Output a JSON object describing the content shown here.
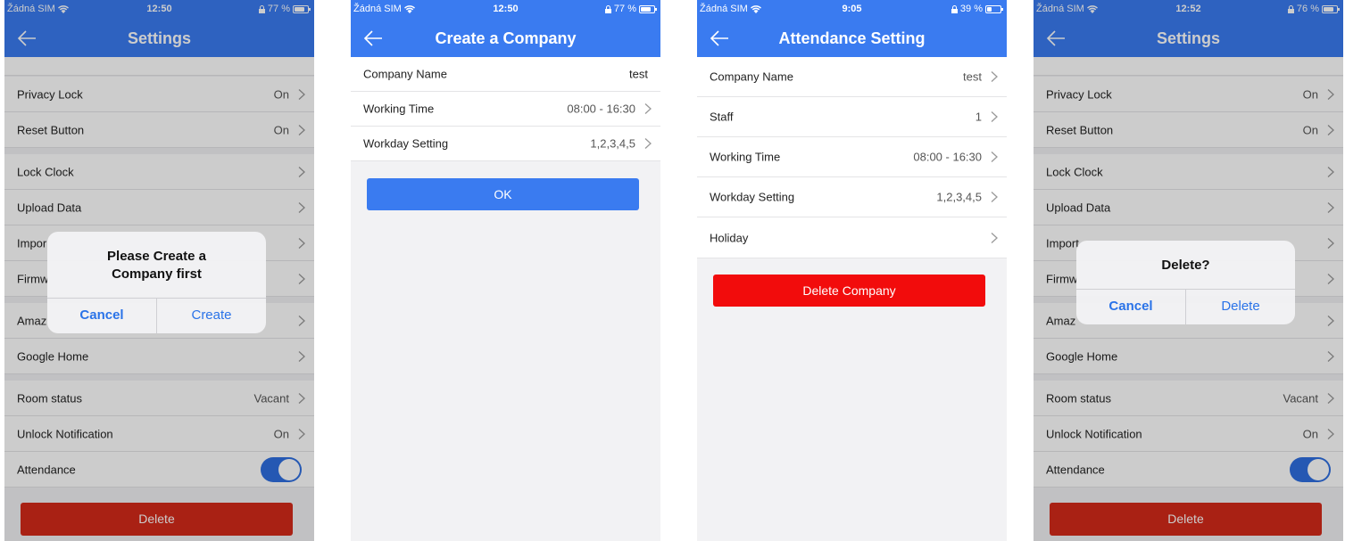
{
  "screens": [
    {
      "status": {
        "carrier": "Žádná SIM",
        "time": "12:50",
        "battery": "77 %",
        "battery_level": 0.77
      },
      "nav_title": "Settings",
      "rows": [
        {
          "label": "Privacy Lock",
          "value": "On"
        },
        {
          "label": "Reset Button",
          "value": "On"
        },
        {
          "label": "Lock Clock",
          "value": ""
        },
        {
          "label": "Upload Data",
          "value": ""
        },
        {
          "label": "Impor",
          "value": ""
        },
        {
          "label": "Firmw",
          "value": ""
        },
        {
          "label": "Amaz",
          "value": ""
        },
        {
          "label": "Google Home",
          "value": ""
        },
        {
          "label": "Room status",
          "value": "Vacant"
        },
        {
          "label": "Unlock Notification",
          "value": "On"
        },
        {
          "label": "Attendance",
          "value": ""
        }
      ],
      "attendance_on": true,
      "delete_label": "Delete",
      "dialog": {
        "message_line1": "Please Create a",
        "message_line2": "Company first",
        "cancel": "Cancel",
        "confirm": "Create"
      }
    },
    {
      "status": {
        "carrier": "Žádná SIM",
        "time": "12:50",
        "battery": "77 %",
        "battery_level": 0.77
      },
      "nav_title": "Create a Company",
      "rows": [
        {
          "label": "Company Name",
          "value": "test"
        },
        {
          "label": "Working Time",
          "value": "08:00 - 16:30"
        },
        {
          "label": "Workday Setting",
          "value": "1,2,3,4,5"
        }
      ],
      "ok_label": "OK"
    },
    {
      "status": {
        "carrier": "Žádná SIM",
        "time": "9:05",
        "battery": "39 %",
        "battery_level": 0.39
      },
      "nav_title": "Attendance Setting",
      "rows": [
        {
          "label": "Company Name",
          "value": "test"
        },
        {
          "label": "Staff",
          "value": "1"
        },
        {
          "label": "Working Time",
          "value": "08:00 - 16:30"
        },
        {
          "label": "Workday Setting",
          "value": "1,2,3,4,5"
        },
        {
          "label": "Holiday",
          "value": ""
        }
      ],
      "delete_company_label": "Delete Company"
    },
    {
      "status": {
        "carrier": "Žádná SIM",
        "time": "12:52",
        "battery": "76 %",
        "battery_level": 0.76
      },
      "nav_title": "Settings",
      "rows": [
        {
          "label": "Privacy Lock",
          "value": "On"
        },
        {
          "label": "Reset Button",
          "value": "On"
        },
        {
          "label": "Lock Clock",
          "value": ""
        },
        {
          "label": "Upload Data",
          "value": ""
        },
        {
          "label": "Import",
          "value": ""
        },
        {
          "label": "Firmw",
          "value": ""
        },
        {
          "label": "Amaz",
          "value": ""
        },
        {
          "label": "Google Home",
          "value": ""
        },
        {
          "label": "Room status",
          "value": "Vacant"
        },
        {
          "label": "Unlock Notification",
          "value": "On"
        },
        {
          "label": "Attendance",
          "value": ""
        }
      ],
      "attendance_on": true,
      "delete_label": "Delete",
      "dialog": {
        "message": "Delete?",
        "cancel": "Cancel",
        "confirm": "Delete"
      }
    }
  ],
  "icons": {
    "back": "arrow-left-icon",
    "chevron": "chevron-right-icon",
    "wifi": "wifi-icon",
    "battery": "battery-icon",
    "lock": "lock-icon"
  },
  "colors": {
    "primary": "#3a7bf0",
    "delete_red": "#d42a1a",
    "company_delete_red": "#f20c0c",
    "dialog_link": "#2a73e8"
  }
}
